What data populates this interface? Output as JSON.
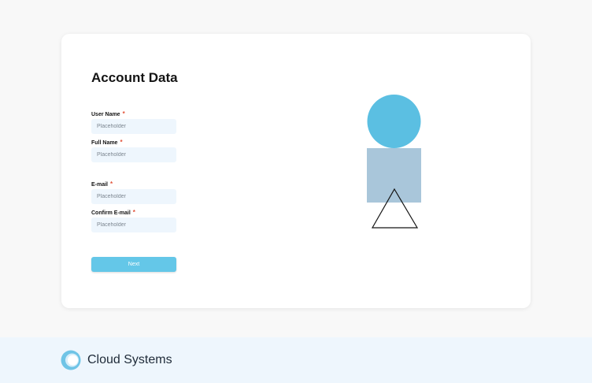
{
  "form": {
    "title": "Account Data",
    "fields": [
      {
        "label": "User Name",
        "required_mark": "*",
        "placeholder": "Placeholder"
      },
      {
        "label": "Full Name",
        "required_mark": "*",
        "placeholder": "Placeholder"
      },
      {
        "label": "E-mail",
        "required_mark": "*",
        "placeholder": "Placeholder"
      },
      {
        "label": "Confirm E-mail",
        "required_mark": "*",
        "placeholder": "Placeholder"
      }
    ],
    "next_label": "Next"
  },
  "illustration": {
    "shapes": [
      "circle",
      "square",
      "triangle"
    ],
    "circle_color": "#5bbfe2",
    "square_color": "#a9c6da",
    "triangle_stroke": "#141414"
  },
  "footer": {
    "brand": "Cloud Systems",
    "logo_icon": "cloud-ring-logo"
  },
  "colors": {
    "accent": "#64c7e8",
    "required": "#e2533a",
    "input_bg": "#eef6fd",
    "footer_bg": "#eef6fd"
  }
}
